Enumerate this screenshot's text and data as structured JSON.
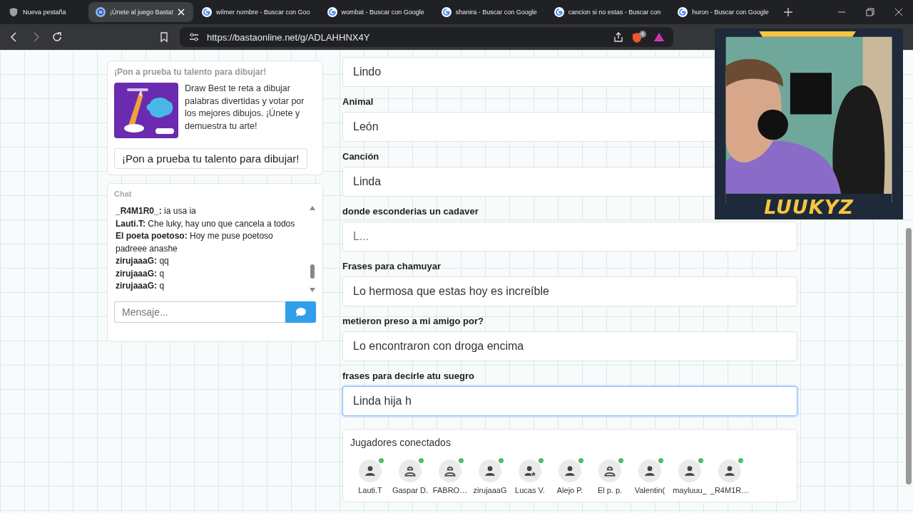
{
  "browser": {
    "tabs": [
      {
        "title": "Nueva pestaña",
        "kind": "shield",
        "selected": false
      },
      {
        "title": "¡Únete al juego Basta!",
        "kind": "site",
        "selected": true
      },
      {
        "title": "wilmer nombre - Buscar con Goo",
        "kind": "google",
        "selected": false
      },
      {
        "title": "wombat - Buscar con Google",
        "kind": "google",
        "selected": false
      },
      {
        "title": "shanira - Buscar con Google",
        "kind": "google",
        "selected": false
      },
      {
        "title": "cancion si no estas - Buscar con",
        "kind": "google",
        "selected": false
      },
      {
        "title": "huron - Buscar con Google",
        "kind": "google",
        "selected": false
      }
    ],
    "url": "https://bastaonline.net/g/ADLAHHNX4Y",
    "shield_count": "4"
  },
  "ad": {
    "heading": "¡Pon a prueba tu talento para dibujar!",
    "description": "Draw Best te reta a dibujar palabras divertidas y votar por los mejores dibujos. ¡Únete y demuestra tu arte!",
    "button": "¡Pon a prueba tu talento para dibujar!"
  },
  "chat": {
    "title": "Chat",
    "messages": [
      {
        "user": "_R4M1R0_:",
        "text": "ia usa ia"
      },
      {
        "user": "Lauti.T:",
        "text": "Che luky, hay uno que cancela a todos"
      },
      {
        "user": "El poeta poetoso:",
        "text": "Hoy me puse poetoso padreee anashe"
      },
      {
        "user": "zirujaaaG:",
        "text": "qq"
      },
      {
        "user": "zirujaaaG:",
        "text": "q"
      },
      {
        "user": "zirujaaaG:",
        "text": "q"
      }
    ],
    "input_placeholder": "Mensaje..."
  },
  "form": {
    "fields": [
      {
        "value": "Lindo",
        "focused": false
      },
      {
        "label": "Animal",
        "value": "León",
        "focused": false
      },
      {
        "label": "Canción",
        "value": "Linda",
        "focused": false
      },
      {
        "label": "donde esconderias un cadaver",
        "placeholder": "L...",
        "focused": false
      },
      {
        "label": "Frases para chamuyar",
        "value": "Lo hermosa que estas hoy es increíble",
        "focused": false
      },
      {
        "label": "metieron preso a mi amigo por?",
        "value": "Lo encontraron con droga encima",
        "focused": false
      },
      {
        "label": "frases para decirle atu suegro",
        "value": "Linda hija h",
        "focused": true
      }
    ]
  },
  "players": {
    "title": "Jugadores conectados",
    "items": [
      {
        "name": "Lauti.T",
        "kind": "user",
        "online": true
      },
      {
        "name": "Gaspar D.",
        "kind": "guest",
        "online": true
      },
      {
        "name": "FABRO…",
        "kind": "guest",
        "online": true
      },
      {
        "name": "zirujaaaG",
        "kind": "user",
        "online": true
      },
      {
        "name": "Lucas V.",
        "kind": "host",
        "online": true
      },
      {
        "name": "Alejo P.",
        "kind": "user",
        "online": true
      },
      {
        "name": "El p. p.",
        "kind": "guest",
        "online": true
      },
      {
        "name": "Valentin(",
        "kind": "user",
        "online": true
      },
      {
        "name": "mayluuu_",
        "kind": "user",
        "online": true
      },
      {
        "name": "_R4M1R…",
        "kind": "user",
        "online": true
      }
    ]
  },
  "stream_overlay": {
    "caption": "LUUKYZ"
  }
}
